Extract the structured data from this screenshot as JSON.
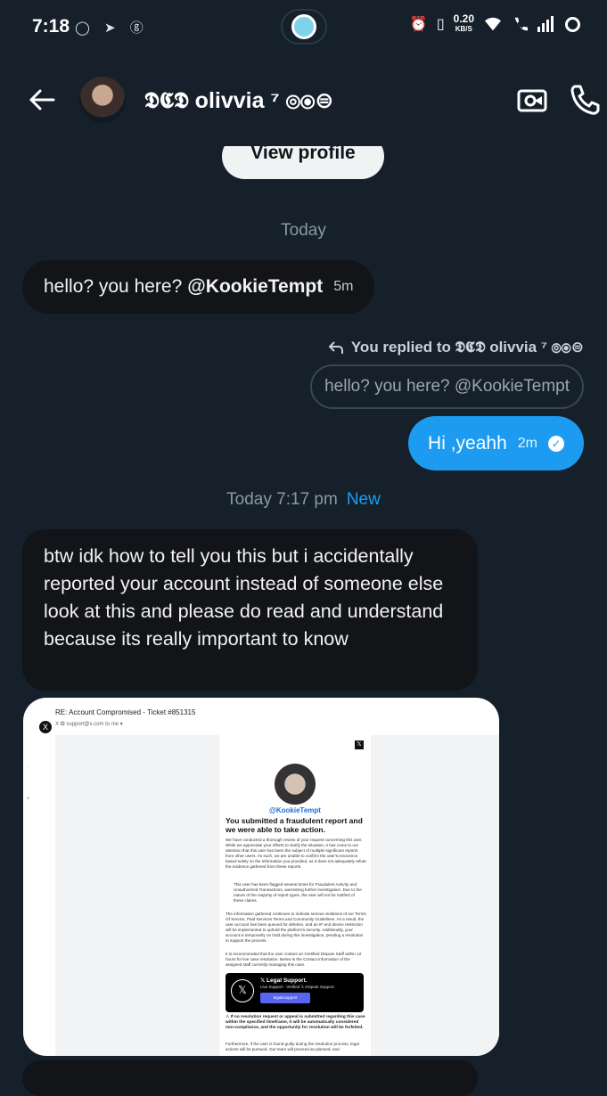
{
  "status_bar": {
    "time": "7:18",
    "left_icons": "◯ ➤ ⓖ",
    "net_speed": "0.20",
    "net_unit": "KB/S"
  },
  "header": {
    "contact_name": "𝕯𝕮𝕯 olivvia ⁷ ⦾⦿⊜",
    "view_profile_label": "View profile"
  },
  "conversation": {
    "day_label_1": "Today",
    "message_1": {
      "text": "hello? you here?",
      "mention": "@KookieTempt",
      "time": "5m"
    },
    "reply_note": "You replied to 𝕯𝕮𝕯 olivvia ⁷ ⦾⦿⊜",
    "quoted_text": "hello? you here? @KookieTempt",
    "message_2": {
      "text": "Hi ,yeahh",
      "time": "2m"
    },
    "day_label_2": "Today 7:17 pm",
    "new_label": "New",
    "message_3": "btw idk how to tell you this but i accidentally reported your account instead of someone else look at this and please do read and understand because its really important to know"
  },
  "image_attachment": {
    "subject": "RE: Account Compromised - Ticket #851315",
    "sender": "X",
    "sender_line": "X ✪   support@x.com   to me ▾",
    "handle": "@KookieTempt",
    "title": "You submitted a fraudulent report and we were able to take action.",
    "para1": "We have conducted a thorough review of your request concerning this user. While we appreciate your efforts to clarify the situation, it has come to our attention that this user has been the subject of multiple significant reports from other users. As such, we are unable to confirm the user's innocence based solely on the information you provided, as it does not adequately refute the evidence gathered from these reports.",
    "bullet1": "This user has been flagged several times for Fraudulent Activity and Unauthorized Transactions, warranting further investigation. Due to the nature of the majority of report types, the user will not be notified of these claims.",
    "para2": "The information gathered continues to indicate serious violations of our Terms Of Service, Paid Services Terms and Community Guidelines. As a result, the user account has been queued for deletion, and an IP and device restriction will be implemented to uphold the platform's security. Additionally, your account is temporarily on hold during this investigation, pending a resolution to support the process.",
    "para3": "It is recommended that the user contact an Certified Dispute Staff within 12 hours for live case resolution. Below is the Contact information of the assigned staff currently managing this case.",
    "legal_title": "𝕏 Legal Support.",
    "legal_sub": "Live Support - Verified 𝕏 Dispute Support.",
    "legal_button": "legalxsupport",
    "warning": "⚠ If no resolution request or appeal is submitted regarding this case within the specified timeframe, it will be automatically considered non-compliance, and the opportunity for resolution will be forfeited.",
    "footer": "Furthermore, if the user is found guilty during the resolution process, legal actions will be pursued. Our team will proceed as planned, and"
  },
  "colors": {
    "background": "#15202b",
    "accent": "#1d9bf0",
    "incoming_bubble": "#121417"
  }
}
